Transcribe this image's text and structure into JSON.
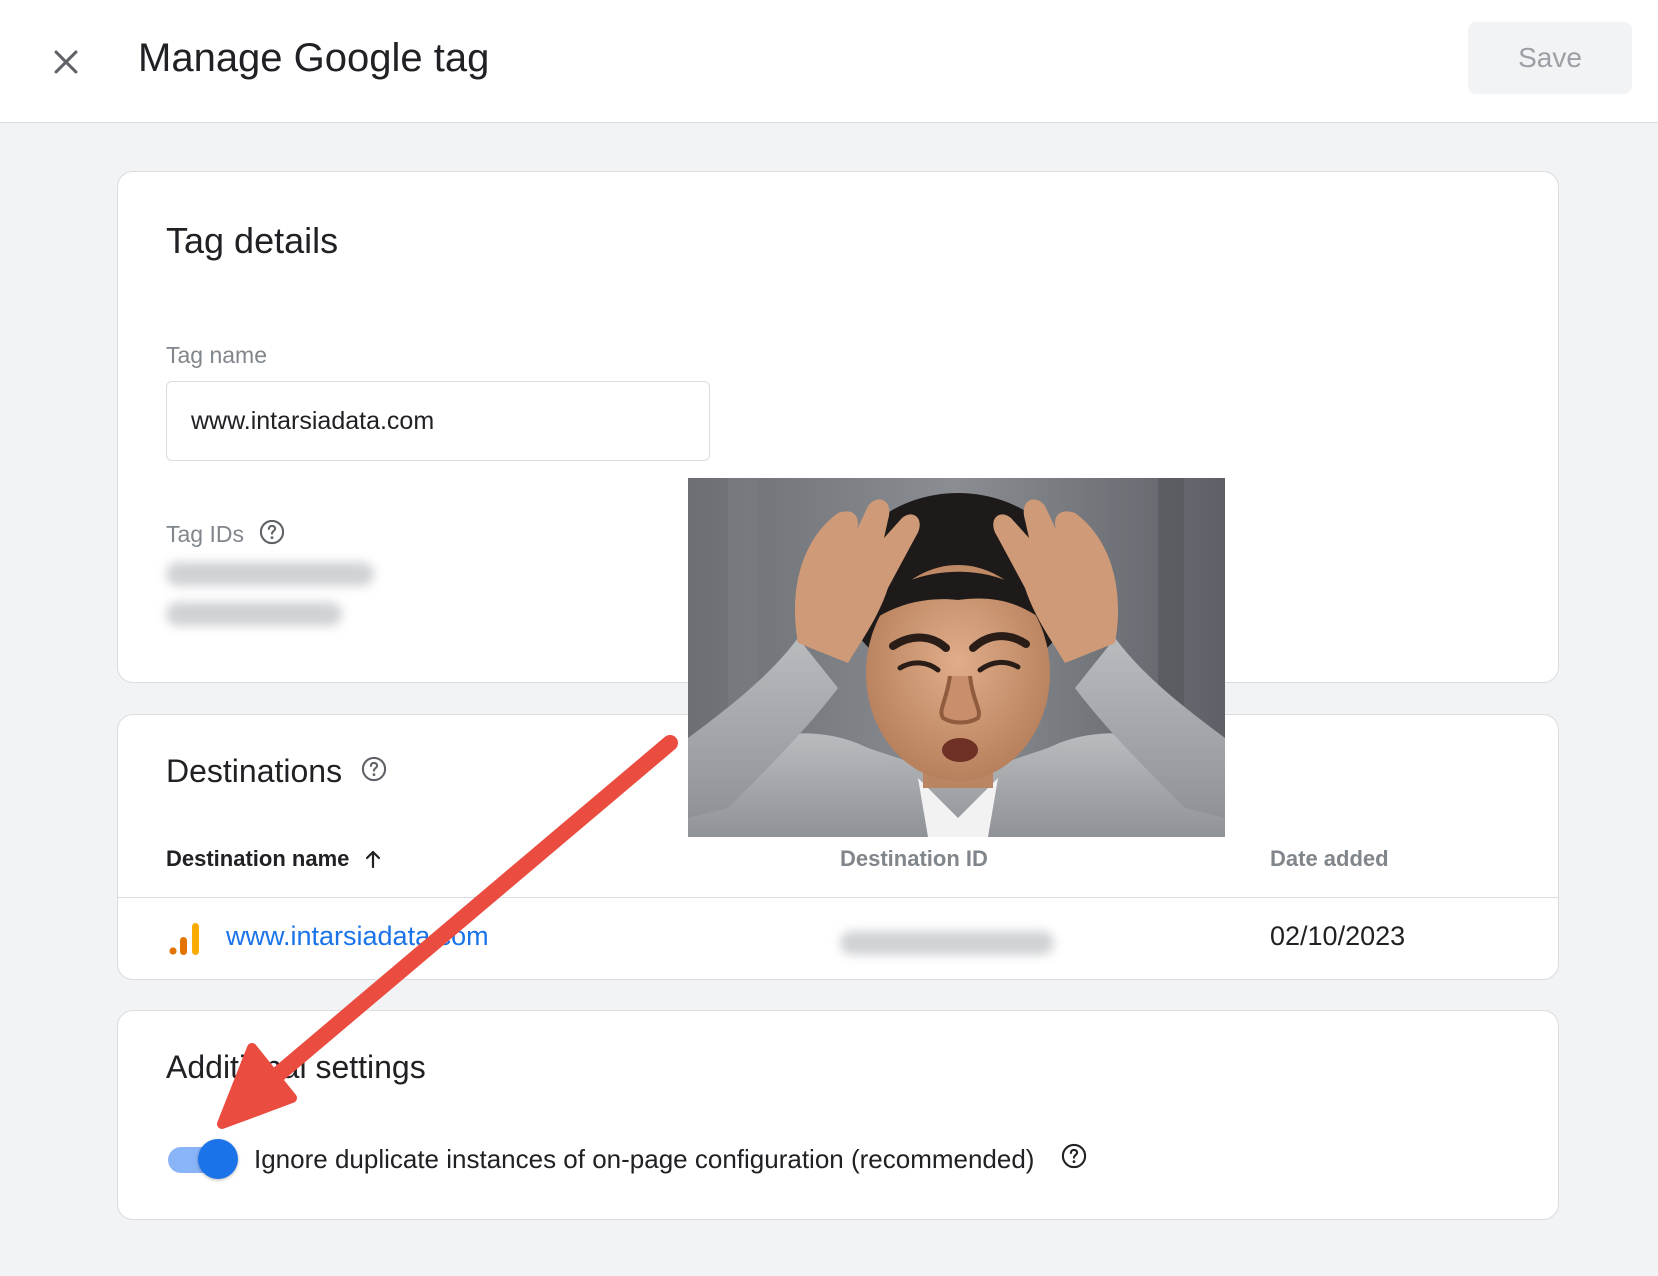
{
  "header": {
    "title": "Manage Google tag",
    "save_label": "Save"
  },
  "tag_details": {
    "title": "Tag details",
    "tag_name_label": "Tag name",
    "tag_name_value": "www.intarsiadata.com",
    "tag_ids_label": "Tag IDs"
  },
  "destinations": {
    "title": "Destinations",
    "columns": {
      "name": "Destination name",
      "id": "Destination ID",
      "date": "Date added"
    },
    "rows": [
      {
        "name": "www.intarsiadata.com",
        "date": "02/10/2023"
      }
    ]
  },
  "additional_settings": {
    "title": "Additional settings",
    "toggle_label": "Ignore duplicate instances of on-page configuration (recommended)",
    "toggle_on": true
  },
  "colors": {
    "accent": "#1a73e8",
    "arrow": "#ea4c3f",
    "analytics_orange": "#f9ab00",
    "analytics_dark_orange": "#e37400"
  },
  "icons": [
    "close-icon",
    "help-icon",
    "sort-arrow-up-icon",
    "analytics-icon",
    "arrow-annotation"
  ]
}
